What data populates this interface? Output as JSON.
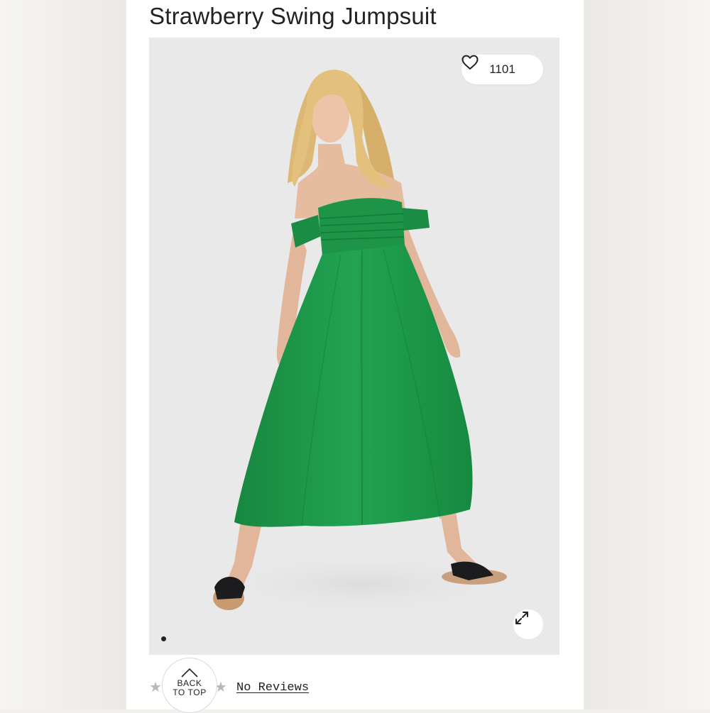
{
  "product": {
    "title": "Strawberry Swing Jumpsuit",
    "likes_count": "1101",
    "carousel": {
      "total_images": 1,
      "active_index": 0
    },
    "dress_color": "#1f9a4c",
    "photo_background": "#e9e9ea"
  },
  "icons": {
    "like": "heart-icon",
    "expand": "expand-arrows-icon",
    "back_to_top": "chevron-up-icon",
    "rating": "star-icon"
  },
  "back_to_top": {
    "line1": "BACK",
    "line2": "TO TOP"
  },
  "reviews": {
    "link_label": "No Reviews",
    "rating": 0
  }
}
